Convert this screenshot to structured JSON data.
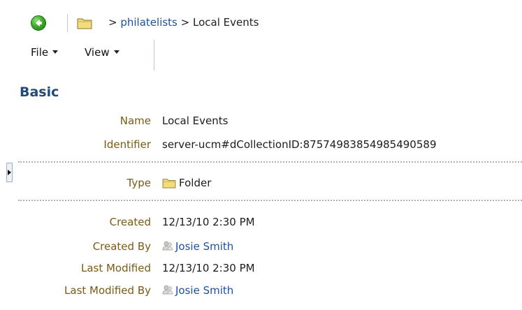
{
  "breadcrumb": {
    "separator": ">",
    "items": [
      "philatelists",
      "Local Events"
    ]
  },
  "menus": {
    "file": "File",
    "view": "View"
  },
  "section": {
    "title": "Basic"
  },
  "properties": {
    "name": {
      "label": "Name",
      "value": "Local Events"
    },
    "identifier": {
      "label": "Identifier",
      "value": "server-ucm#dCollectionID:875749838549854905​89"
    },
    "type": {
      "label": "Type",
      "value": "Folder",
      "icon": "folder-icon"
    },
    "created": {
      "label": "Created",
      "value": "12/13/10 2:30 PM"
    },
    "created_by": {
      "label": "Created By",
      "value": "Josie Smith",
      "icon": "user-icon"
    },
    "last_modified": {
      "label": "Last Modified",
      "value": "12/13/10 2:30 PM"
    },
    "last_modified_by": {
      "label": "Last Modified By",
      "value": "Josie Smith",
      "icon": "user-icon"
    }
  },
  "colors": {
    "label": "#7a5a14",
    "link": "#1e4f9c",
    "heading": "#1f4a7a",
    "back_button": "#3eac2a"
  }
}
